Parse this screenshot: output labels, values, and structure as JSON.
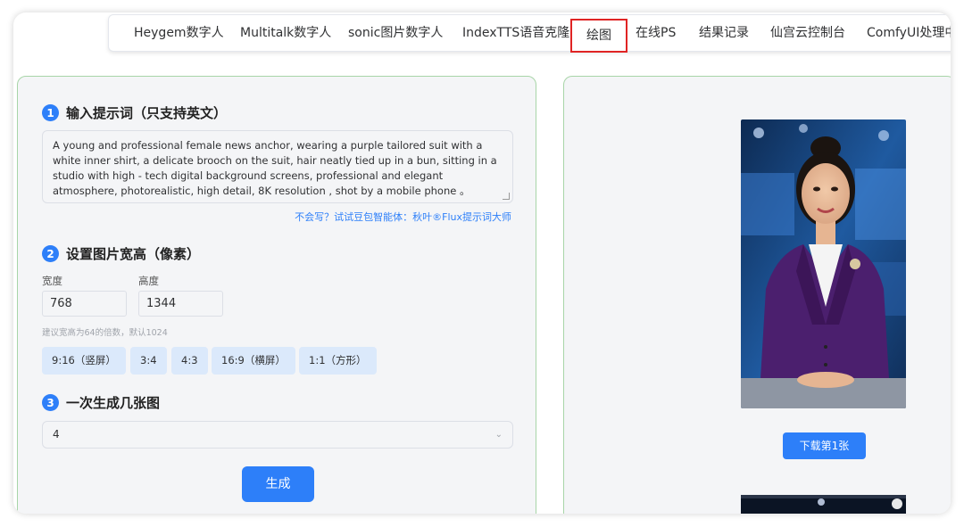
{
  "nav": {
    "items": [
      {
        "label": "Heygem数字人",
        "active": false
      },
      {
        "label": "Multitalk数字人",
        "active": false
      },
      {
        "label": "sonic图片数字人",
        "active": false
      },
      {
        "label": "IndexTTS语音克隆",
        "active": false
      },
      {
        "label": "绘图",
        "active": true
      },
      {
        "label": "在线PS",
        "active": false
      },
      {
        "label": "结果记录",
        "active": false
      },
      {
        "label": "仙宫云控制台",
        "active": false
      },
      {
        "label": "ComfyUI处理中",
        "active": false
      }
    ]
  },
  "form": {
    "step1": {
      "num": "1",
      "title": "输入提示词（只支持英文）"
    },
    "prompt_value": "A young and professional female news anchor, wearing a purple tailored suit with a white inner shirt, a delicate brooch on the suit, hair neatly tied up in a bun, sitting in a studio with high - tech digital background screens, professional and elegant atmosphere, photorealistic, high detail, 8K resolution ,  shot by a mobile phone 。",
    "hint_link": "不会写？试试豆包智能体：秋叶®Flux提示词大师",
    "step2": {
      "num": "2",
      "title": "设置图片宽高（像素）"
    },
    "width_label": "宽度",
    "height_label": "高度",
    "width_value": "768",
    "height_value": "1344",
    "tip": "建议宽高为64的倍数，默认1024",
    "ratios": [
      "9:16（竖屏）",
      "3:4",
      "4:3",
      "16:9（横屏）",
      "1:1（方形）"
    ],
    "step3": {
      "num": "3",
      "title": "一次生成几张图"
    },
    "count_value": "4",
    "generate_label": "生成"
  },
  "result": {
    "download_label": "下载第1张"
  },
  "colors": {
    "accent": "#2d7ff9",
    "panel_border": "#a8d5a8",
    "active_nav_border": "#e02424",
    "suit": "#4b1f6e"
  }
}
